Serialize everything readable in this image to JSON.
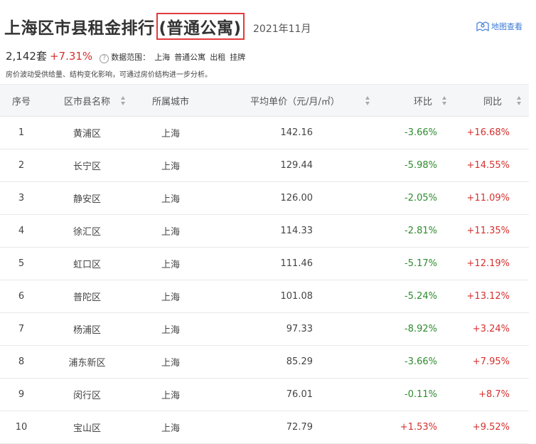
{
  "header": {
    "title_main": "上海区市县租金排行",
    "title_highlight": "(普通公寓)",
    "date": "2021年11月",
    "map_link": "地图查看",
    "map_icon": "map-pin-icon"
  },
  "stats": {
    "count": "2,142套",
    "change": "+7.31%",
    "scope_label": "数据范围：",
    "scope_items": [
      "上海",
      "普通公寓",
      "出租",
      "挂牌"
    ],
    "note": "房价波动受供给量、结构变化影响，可通过房价结构进一步分析。"
  },
  "table": {
    "headers": [
      "序号",
      "区市县名称",
      "所属城市",
      "平均单价（元/月/㎡）",
      "环比",
      "同比"
    ],
    "rows": [
      {
        "rank": "1",
        "name": "黄浦区",
        "city": "上海",
        "price": "142.16",
        "mom": "-3.66%",
        "yoy": "+16.68%"
      },
      {
        "rank": "2",
        "name": "长宁区",
        "city": "上海",
        "price": "129.44",
        "mom": "-5.98%",
        "yoy": "+14.55%"
      },
      {
        "rank": "3",
        "name": "静安区",
        "city": "上海",
        "price": "126.00",
        "mom": "-2.05%",
        "yoy": "+11.09%"
      },
      {
        "rank": "4",
        "name": "徐汇区",
        "city": "上海",
        "price": "114.33",
        "mom": "-2.81%",
        "yoy": "+11.35%"
      },
      {
        "rank": "5",
        "name": "虹口区",
        "city": "上海",
        "price": "111.46",
        "mom": "-5.17%",
        "yoy": "+12.19%"
      },
      {
        "rank": "6",
        "name": "普陀区",
        "city": "上海",
        "price": "101.08",
        "mom": "-5.24%",
        "yoy": "+13.12%"
      },
      {
        "rank": "7",
        "name": "杨浦区",
        "city": "上海",
        "price": "97.33",
        "mom": "-8.92%",
        "yoy": "+3.24%"
      },
      {
        "rank": "8",
        "name": "浦东新区",
        "city": "上海",
        "price": "85.29",
        "mom": "-3.66%",
        "yoy": "+7.95%"
      },
      {
        "rank": "9",
        "name": "闵行区",
        "city": "上海",
        "price": "76.01",
        "mom": "-0.11%",
        "yoy": "+8.7%"
      },
      {
        "rank": "10",
        "name": "宝山区",
        "city": "上海",
        "price": "72.79",
        "mom": "+1.53%",
        "yoy": "+9.52%"
      }
    ]
  },
  "colors": {
    "positive": "#d4312f",
    "negative": "#2e8b2e",
    "link": "#3b7bd6",
    "highlight_border": "#e23b3b"
  }
}
